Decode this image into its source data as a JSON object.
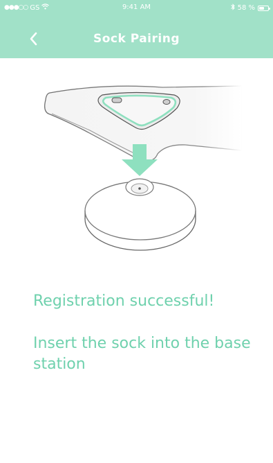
{
  "status_bar": {
    "carrier": "GS",
    "time": "9:41 AM",
    "battery": "58 %",
    "battery_level": 0.58
  },
  "nav": {
    "title": "Sock Pairing",
    "back_icon": "chevron-left-icon"
  },
  "illustration": {
    "description_icon": "sock-into-base-station-illustration",
    "accent": "#8ee0bf"
  },
  "messages": {
    "success": "Registration successful!",
    "instruction": "Insert the sock into the base station"
  },
  "colors": {
    "header_bg": "#a1e1c8",
    "accent_text": "#6fd1ad"
  }
}
